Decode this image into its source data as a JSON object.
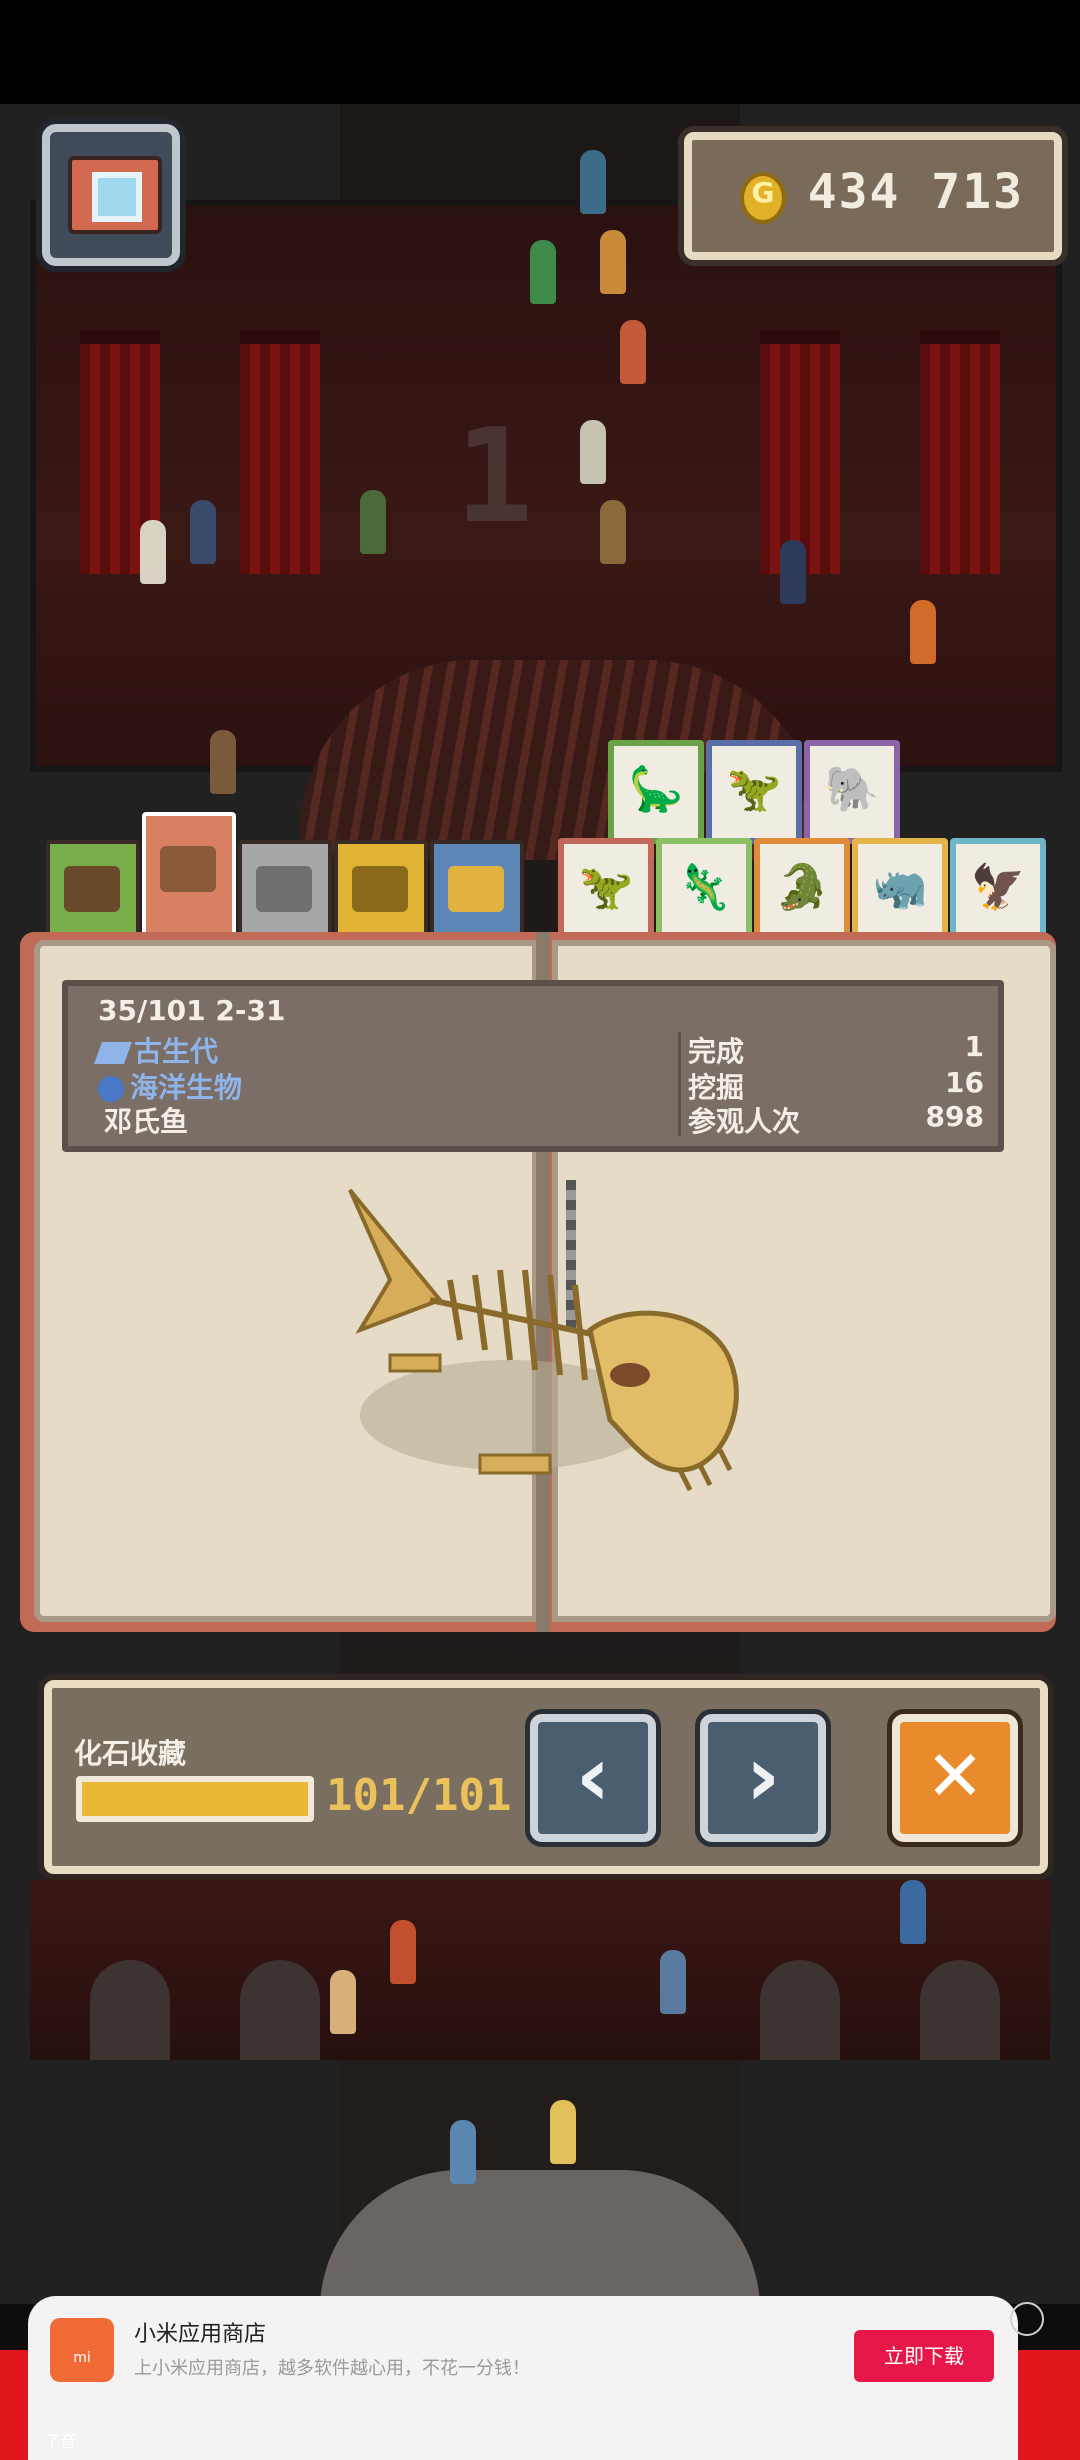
{
  "currency": {
    "icon": "coin-icon",
    "coin_symbol": "G",
    "value": "434 713"
  },
  "museum": {
    "floor_number": "1"
  },
  "tabs": {
    "categories": [
      {
        "name": "barrel-tab",
        "color": "#7ab04c",
        "selected": false
      },
      {
        "name": "red-exhibit-tab",
        "color": "#d98062",
        "selected": true
      },
      {
        "name": "gray-exhibit-tab",
        "color": "#a5a7a8",
        "selected": false
      },
      {
        "name": "gold-exhibit-tab",
        "color": "#e1b436",
        "selected": false
      },
      {
        "name": "blue-exhibit-tab",
        "color": "#5b86b5",
        "selected": false
      }
    ],
    "dinosaurs_top": [
      {
        "name": "sauropod-tab",
        "color": "#6aa24a"
      },
      {
        "name": "raptor-tab",
        "color": "#5a6fa8"
      },
      {
        "name": "mammoth-tab",
        "color": "#8a66a8"
      }
    ],
    "dinosaurs_bottom": [
      {
        "name": "trex-tab",
        "color": "#c16a5a"
      },
      {
        "name": "iguanodon-tab",
        "color": "#8cc064"
      },
      {
        "name": "stegosaurus-tab",
        "color": "#e08a3a"
      },
      {
        "name": "triceratops-tab",
        "color": "#e4b44a"
      },
      {
        "name": "pterosaur-tab",
        "color": "#6fb5c8"
      }
    ]
  },
  "fossil": {
    "index_line": "35/101 2-31",
    "era": "古生代",
    "category": "海洋生物",
    "name": "邓氏鱼",
    "stats": [
      {
        "label": "完成",
        "value": "1"
      },
      {
        "label": "挖掘",
        "value": "16"
      },
      {
        "label": "参观人次",
        "value": "898"
      }
    ]
  },
  "collection": {
    "label": "化石收藏",
    "count": "101/101",
    "progress": 1.0,
    "prev_symbol": "‹",
    "next_symbol": "›",
    "close_symbol": "✕"
  },
  "ad": {
    "logo": "mi",
    "title": "小米应用商店",
    "description": "上小米应用商店，越多软件越心用，不花一分钱！",
    "button": "立即下载",
    "brand": "了音"
  }
}
